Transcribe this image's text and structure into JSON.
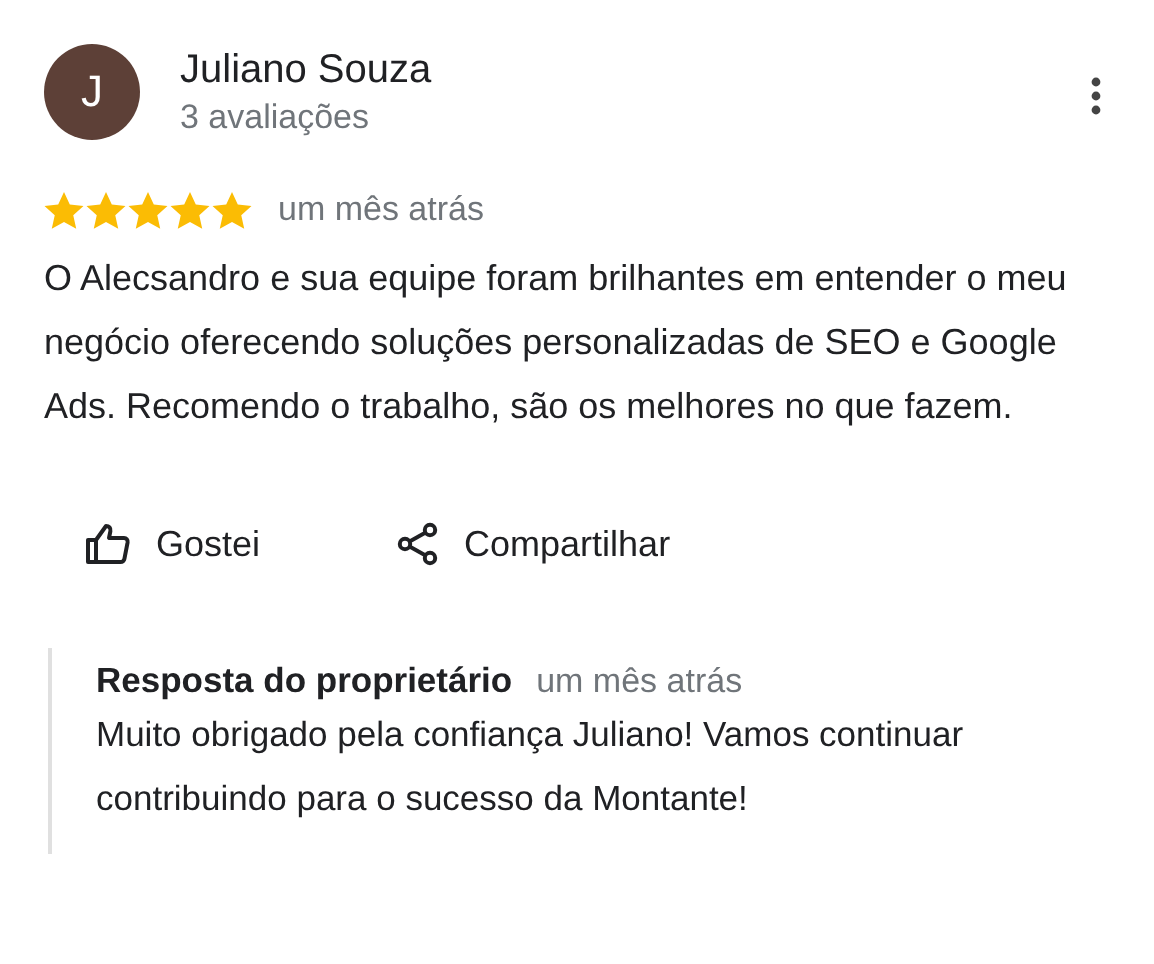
{
  "review": {
    "avatar_letter": "J",
    "author": "Juliano Souza",
    "review_count": "3 avaliações",
    "stars": 5,
    "time": "um mês atrás",
    "text": "O Alecsandro e sua equipe foram brilhantes em entender o meu negócio oferecendo soluções personalizadas de SEO e Google Ads. Recomendo o trabalho, são os melhores no que fazem.",
    "actions": [
      {
        "kind": "like",
        "label": "Gostei"
      },
      {
        "kind": "share",
        "label": "Compartilhar"
      }
    ],
    "owner_response": {
      "label": "Resposta do proprietário",
      "time": "um mês atrás",
      "text": "Muito obrigado pela confiança Juliano! Vamos continuar contribuindo para o sucesso da Montante!"
    }
  }
}
